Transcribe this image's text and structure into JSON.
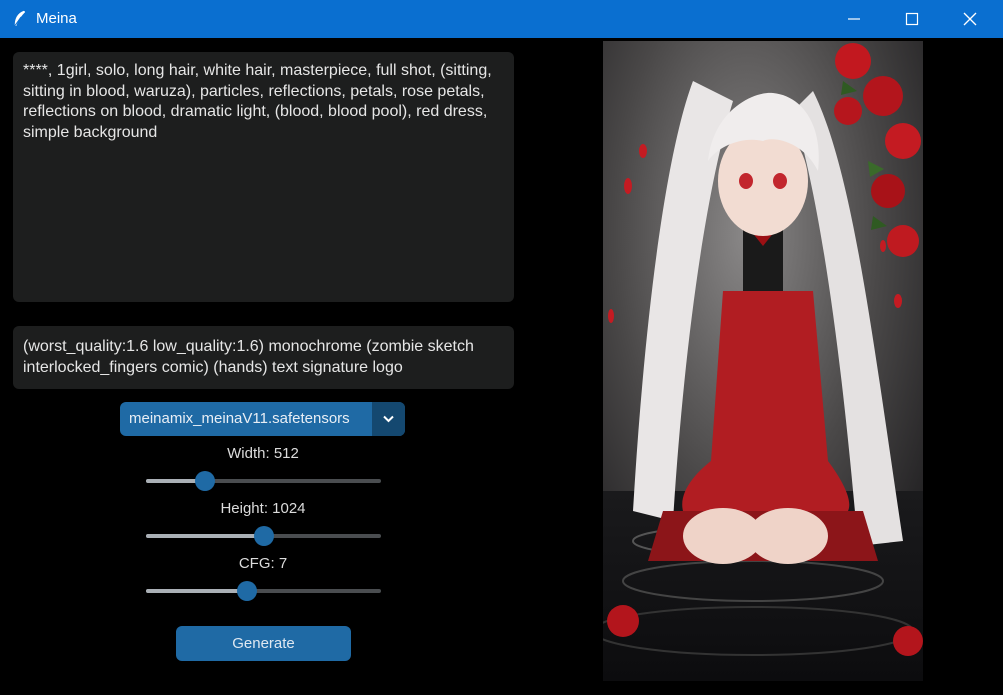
{
  "window": {
    "title": "Meina",
    "controls": {
      "minimize": "minimize-icon",
      "maximize": "maximize-icon",
      "close": "close-icon"
    }
  },
  "prompt": {
    "text": "****, 1girl, solo, long hair, white hair, masterpiece, full shot, (sitting, sitting in blood, waruza), particles, reflections, petals, rose petals, reflections on blood, dramatic light, (blood, blood pool), red dress, simple background"
  },
  "negative_prompt": {
    "text": "(worst_quality:1.6 low_quality:1.6) monochrome (zombie sketch interlocked_fingers comic) (hands) text signature logo"
  },
  "model": {
    "selected": "meinamix_meinaV11.safetensors"
  },
  "width": {
    "label": "Width: 512",
    "value": 512,
    "level": 0.25
  },
  "height": {
    "label": "Height: 1024",
    "value": 1024,
    "level": 0.5
  },
  "cfg": {
    "label": "CFG: 7",
    "value": 7,
    "level": 0.43
  },
  "generate": {
    "label": "Generate"
  },
  "colors": {
    "accent": "#1f6aa5",
    "titlebar": "#0a6fd0",
    "panel": "#1d1e1e",
    "background": "#000000"
  }
}
